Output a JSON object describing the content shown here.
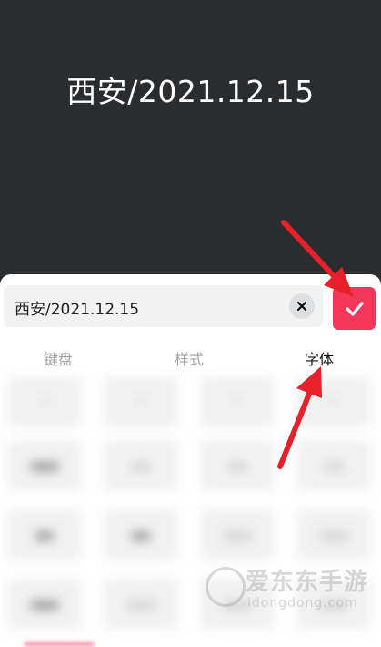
{
  "preview": {
    "text": "西安/2021.12.15"
  },
  "editor": {
    "input_value": "西安/2021.12.15",
    "clear_icon": "close-icon",
    "confirm_icon": "check-icon",
    "accent_color": "#f2375a"
  },
  "tabs": [
    {
      "label": "键盘",
      "active": false
    },
    {
      "label": "样式",
      "active": false
    },
    {
      "label": "字体",
      "active": true
    }
  ],
  "annotation_color": "#e8202a",
  "watermark": {
    "text": "爱东东手游",
    "sub": "idongdong.com"
  }
}
